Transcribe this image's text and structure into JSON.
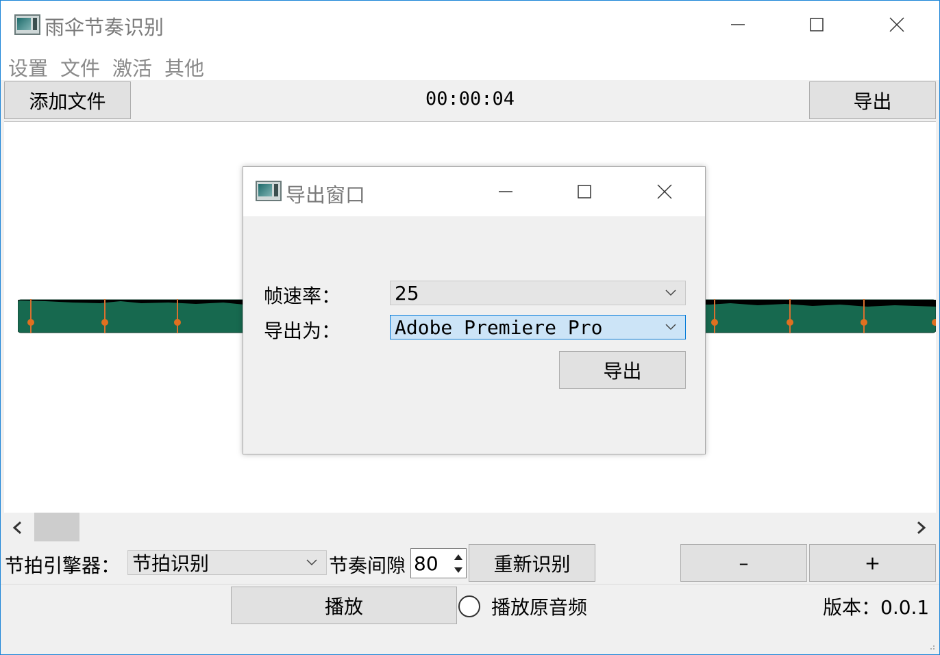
{
  "app": {
    "title": "雨伞节奏识别",
    "icon": "app-window-icon"
  },
  "window_controls": {
    "minimize": "minimize-icon",
    "maximize": "maximize-icon",
    "close": "close-icon"
  },
  "menu": {
    "items": [
      "设置",
      "文件",
      "激活",
      "其他"
    ]
  },
  "toolbar": {
    "add_file_label": "添加文件",
    "time": "00:00:04",
    "export_label": "导出"
  },
  "colors": {
    "waveform_fill": "#17694f",
    "waveform_peak": "#000000",
    "beat_marker": "#e07020",
    "accent_border": "#1883d7"
  },
  "controls": {
    "beat_engine_label": "节拍引擎器：",
    "beat_engine_value": "节拍识别",
    "rhythm_gap_label": "节奏间隙",
    "rhythm_gap_value": "80",
    "recognize_label": "重新识别",
    "minus_label": "–",
    "plus_label": "+"
  },
  "playback": {
    "play_label": "播放",
    "original_audio_label": "播放原音频",
    "version": "版本：0.0.1"
  },
  "dialog": {
    "title": "导出窗口",
    "fps_label": "帧速率：",
    "fps_value": "25",
    "export_as_label": "导出为：",
    "export_as_value": "Adobe Premiere Pro",
    "export_button": "导出"
  }
}
